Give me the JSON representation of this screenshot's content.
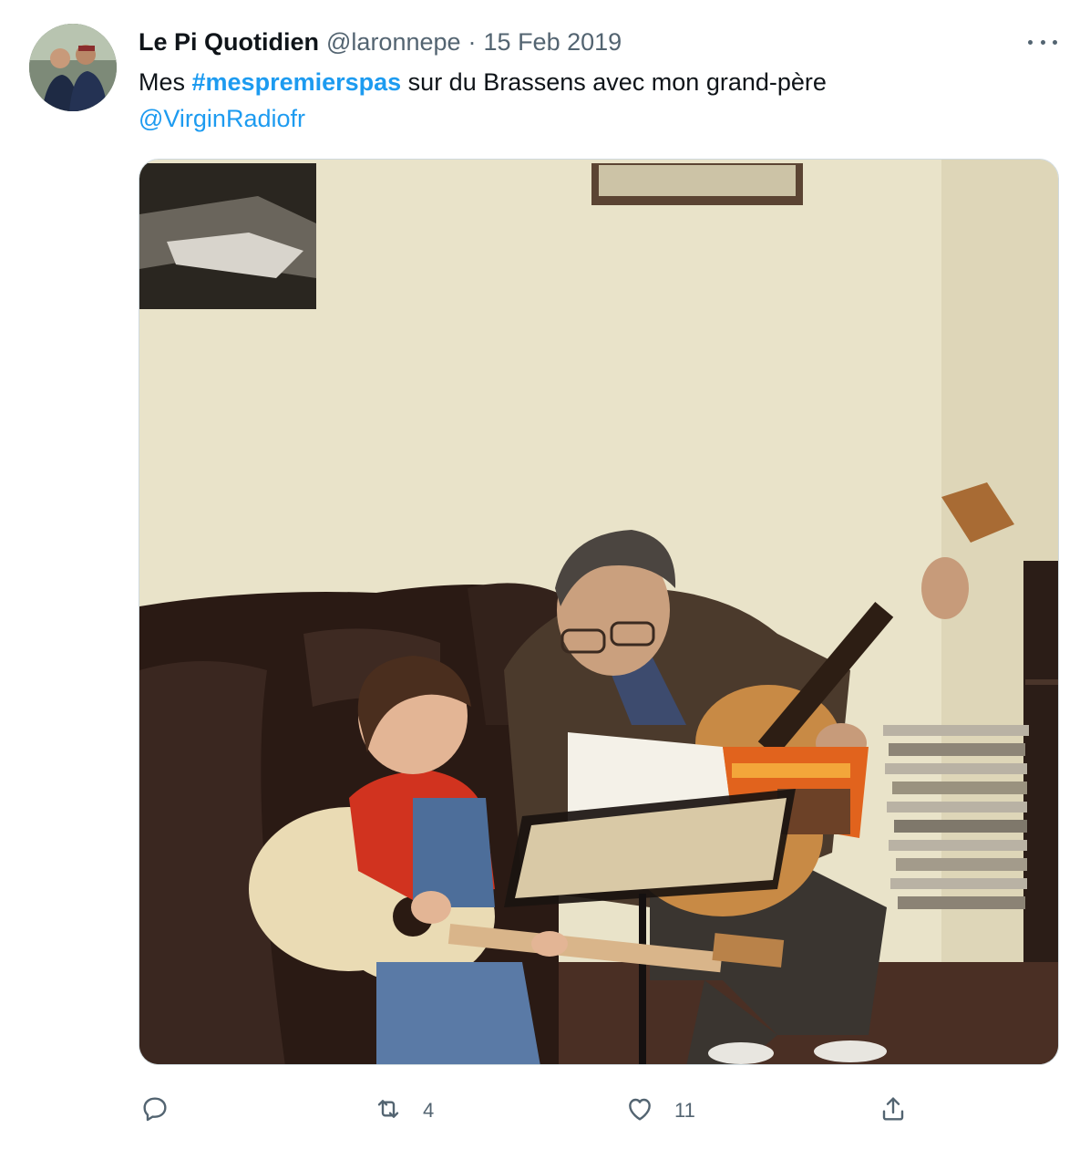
{
  "tweet": {
    "author_name": "Le Pi Quotidien",
    "handle": "@laronnepe",
    "separator": "·",
    "date": "15 Feb 2019",
    "text_before": "Mes ",
    "hashtag": "#mespremierspas",
    "text_after": " sur du Brassens avec mon grand-père",
    "mention": "@VirginRadiofr"
  },
  "actions": {
    "reply_icon": "reply-icon",
    "retweet_icon": "retweet-icon",
    "retweet_count": "4",
    "like_icon": "heart-icon",
    "like_count": "11",
    "share_icon": "share-icon"
  },
  "colors": {
    "link": "#1d9bf0",
    "secondary_text": "#536471",
    "primary_text": "#0f1419"
  }
}
